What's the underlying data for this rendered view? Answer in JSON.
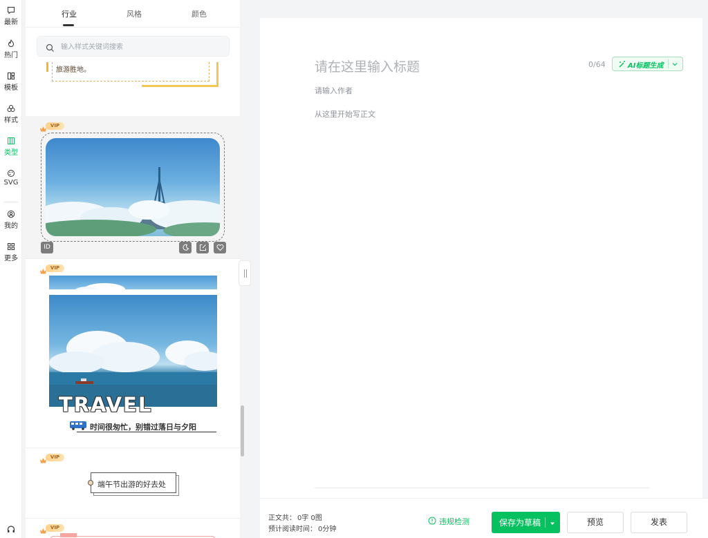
{
  "rail": {
    "items": [
      {
        "label": "最新",
        "icon": "message-square-icon"
      },
      {
        "label": "热门",
        "icon": "flame-icon"
      },
      {
        "label": "模板",
        "icon": "layout-grid-icon"
      },
      {
        "label": "样式",
        "icon": "shapes-icon"
      },
      {
        "label": "类型",
        "icon": "columns-icon",
        "active": true
      },
      {
        "label": "SVG",
        "icon": "palette-icon"
      },
      {
        "label": "我的",
        "icon": "user-icon"
      },
      {
        "label": "更多",
        "icon": "apps-icon"
      }
    ]
  },
  "panel": {
    "tabs": [
      {
        "label": "行业",
        "active": true
      },
      {
        "label": "风格"
      },
      {
        "label": "颜色"
      }
    ],
    "search": {
      "placeholder": "输入样式关键词搜索",
      "value": ""
    },
    "cards": {
      "card1_text": "旅游胜地。",
      "vip_label": "VIP",
      "card2_id": "ID",
      "card3_title": "TRAVEL",
      "card3_subtitle": "时间很匆忙，别错过落日与夕阳",
      "card4_text": "端午节出游的好去处"
    }
  },
  "editor": {
    "title_placeholder": "请在这里输入标题",
    "title_counter": "0/64",
    "ai_button_label": "AI标题生成",
    "author_placeholder": "请输入作者",
    "body_placeholder": "从这里开始写正文"
  },
  "footer": {
    "word_count_label": "正文共：",
    "word_count_value": "0字 0图",
    "read_time_label": "预计阅读时间：",
    "read_time_value": "0分钟",
    "compliance_label": "违规检测",
    "save_draft_label": "保存为草稿",
    "preview_label": "预览",
    "publish_label": "发表"
  },
  "colors": {
    "accent": "#07c160",
    "vip_gold": "#ffd08a"
  }
}
